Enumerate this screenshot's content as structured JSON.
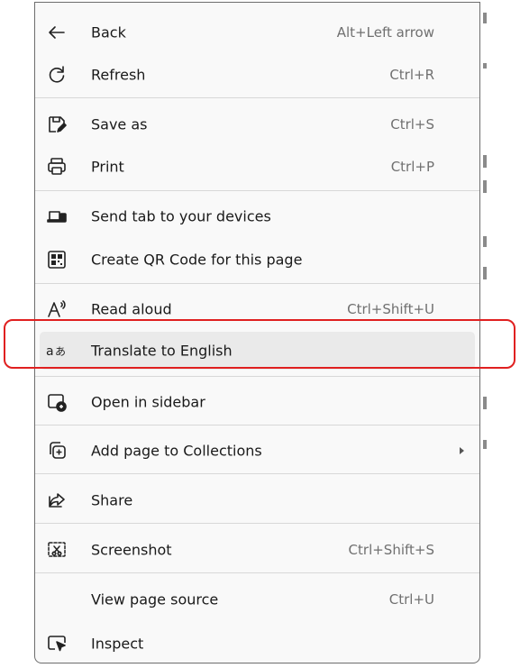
{
  "menu": {
    "items": [
      {
        "name": "back",
        "icon": "back-arrow-icon",
        "label": "Back",
        "shortcut": "Alt+Left arrow"
      },
      {
        "name": "refresh",
        "icon": "refresh-icon",
        "label": "Refresh",
        "shortcut": "Ctrl+R"
      },
      {
        "name": "save-as",
        "icon": "save-as-icon",
        "label": "Save as",
        "shortcut": "Ctrl+S"
      },
      {
        "name": "print",
        "icon": "printer-icon",
        "label": "Print",
        "shortcut": "Ctrl+P"
      },
      {
        "name": "send-tab",
        "icon": "devices-icon",
        "label": "Send tab to your devices",
        "shortcut": ""
      },
      {
        "name": "qr-code",
        "icon": "qr-code-icon",
        "label": "Create QR Code for this page",
        "shortcut": ""
      },
      {
        "name": "read-aloud",
        "icon": "read-aloud-icon",
        "label": "Read aloud",
        "shortcut": "Ctrl+Shift+U"
      },
      {
        "name": "translate",
        "icon": "translate-icon",
        "label": "Translate to English",
        "shortcut": "",
        "highlighted": true
      },
      {
        "name": "open-in-sidebar",
        "icon": "sidebar-icon",
        "label": "Open in sidebar",
        "shortcut": ""
      },
      {
        "name": "add-to-collections",
        "icon": "collections-add-icon",
        "label": "Add page to Collections",
        "shortcut": "",
        "submenu": true
      },
      {
        "name": "share",
        "icon": "share-icon",
        "label": "Share",
        "shortcut": ""
      },
      {
        "name": "screenshot",
        "icon": "screenshot-icon",
        "label": "Screenshot",
        "shortcut": "Ctrl+Shift+S"
      },
      {
        "name": "view-source",
        "icon": "",
        "label": "View page source",
        "shortcut": "Ctrl+U"
      },
      {
        "name": "inspect",
        "icon": "inspect-icon",
        "label": "Inspect",
        "shortcut": ""
      }
    ]
  },
  "colors": {
    "highlight_row": "#eaeaea",
    "callout_border": "#e02020",
    "menu_bg": "#f9f9f9"
  }
}
